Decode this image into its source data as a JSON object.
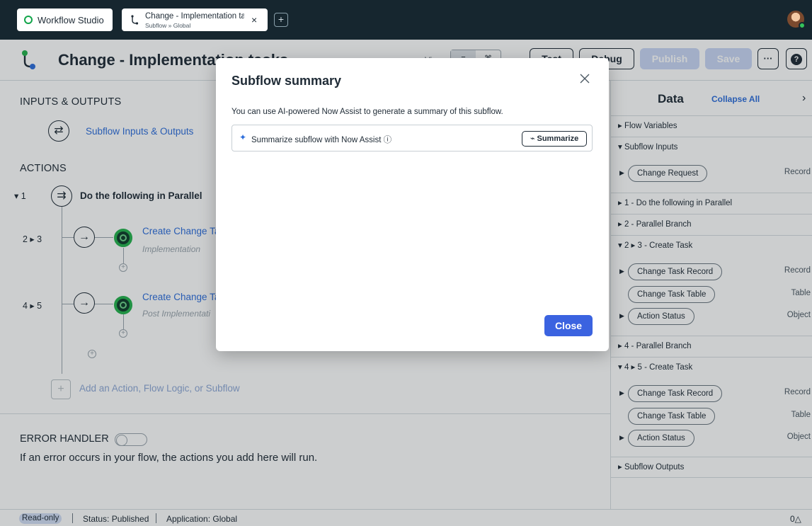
{
  "topbar": {
    "app_name": "Workflow Studio",
    "doc_tab_title": "Change - Implementation ta",
    "doc_tab_subtitle": "Subflow » Global",
    "close_glyph": "×",
    "add_glyph": "+"
  },
  "titlebar": {
    "title": "Change - Implementation tasks",
    "view_label": "View",
    "view_options": [
      "≡",
      "⌘"
    ],
    "test_label": "Test",
    "debug_label": "Debug",
    "publish_label": "Publish",
    "save_label": "Save",
    "more_glyph": "···",
    "help_glyph": "?"
  },
  "canvas": {
    "inputs_outputs_heading": "INPUTS & OUTPUTS",
    "inputs_outputs_link": "Subflow Inputs & Outputs",
    "actions_heading": "ACTIONS",
    "steps": [
      {
        "num": "▾ 1",
        "title": "Do the following in Parallel"
      },
      {
        "num": "2 ▸ 3",
        "title": "Create Change Ta",
        "subtitle": "Implementation"
      },
      {
        "num": "4 ▸ 5",
        "title": "Create Change Ta",
        "subtitle": "Post Implementati"
      }
    ],
    "add_placeholder": "Add an Action, Flow Logic, or Subflow",
    "error_handler_heading": "ERROR HANDLER",
    "error_handler_desc": "If an error occurs in your flow, the actions you add here will run."
  },
  "data_panel": {
    "title": "Data",
    "collapse_all": "Collapse All",
    "sections": {
      "flow_variables": "▸ Flow Variables",
      "subflow_inputs": "▾ Subflow Inputs",
      "s1": "▸ 1 - Do the following in Parallel",
      "s2": "▸ 2 - Parallel Branch",
      "s23": "▾ 2 ▸ 3 - Create Task",
      "s4": "▸ 4 - Parallel Branch",
      "s45": "▾ 4 ▸ 5 - Create Task",
      "outputs": "▸ Subflow Outputs"
    },
    "inputs": [
      {
        "label": "Change Request",
        "type": "Record"
      }
    ],
    "task23": [
      {
        "label": "Change Task Record",
        "type": "Record"
      },
      {
        "label": "Change Task Table",
        "type": "Table"
      },
      {
        "label": "Action Status",
        "type": "Object"
      }
    ],
    "task45": [
      {
        "label": "Change Task Record",
        "type": "Record"
      },
      {
        "label": "Change Task Table",
        "type": "Table"
      },
      {
        "label": "Action Status",
        "type": "Object"
      }
    ]
  },
  "statusbar": {
    "read_only": "Read-only",
    "status": "Status: Published",
    "application": "Application: Global",
    "notifications": "0△"
  },
  "modal": {
    "title": "Subflow summary",
    "description": "You can use AI-powered Now Assist to generate a summary of this subflow.",
    "assist_text": "Summarize subflow with Now Assist ⓘ",
    "summarize_label": "⌁ Summarize",
    "close_label": "Close"
  },
  "colors": {
    "topbar_bg": "#16262f",
    "accent_blue": "#3b63e0",
    "link_blue": "#2e6edb",
    "brand_green": "#25b24d"
  },
  "icons": [
    "app-logo-icon",
    "subflow-icon",
    "close-icon",
    "plus-icon",
    "parallel-icon",
    "arrow-right-icon",
    "action-icon",
    "sparkle-icon",
    "info-icon",
    "chevron-right-icon"
  ]
}
